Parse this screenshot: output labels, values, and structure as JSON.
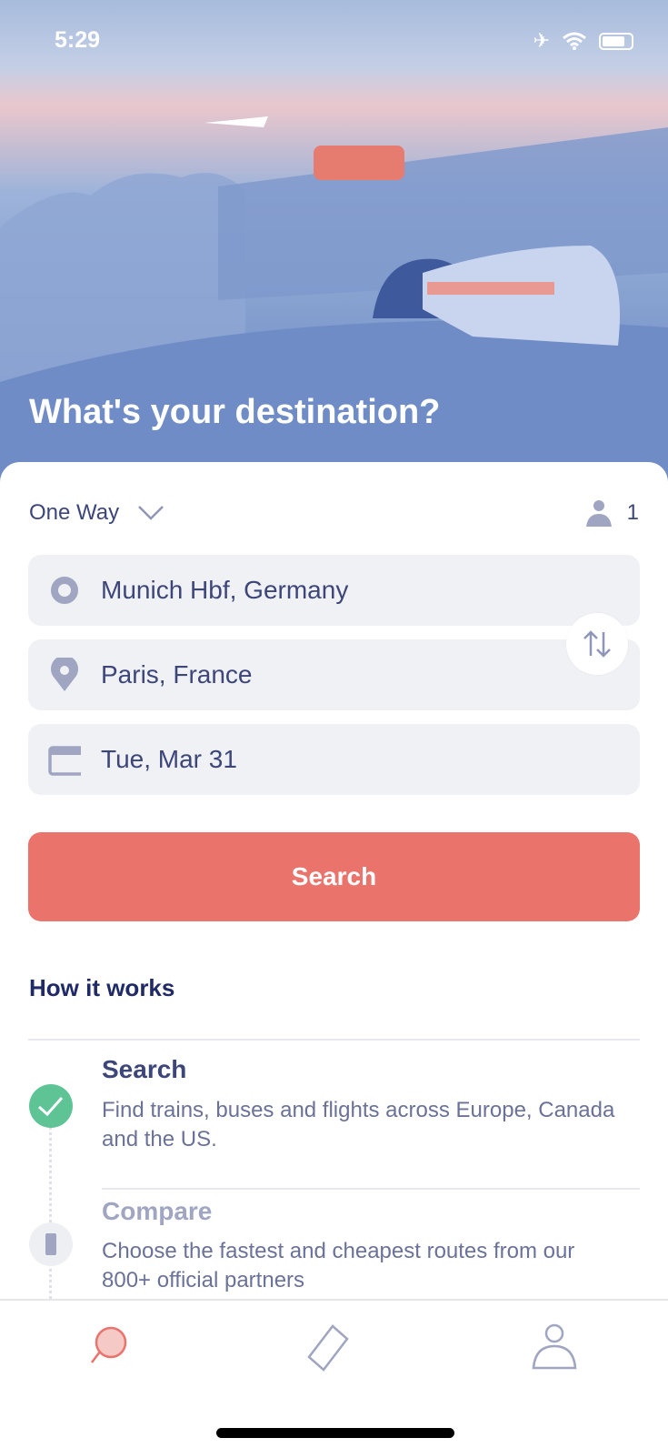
{
  "status_bar": {
    "time": "5:29",
    "icons": [
      "airplane-mode-icon",
      "wifi-icon",
      "battery-icon"
    ]
  },
  "hero": {
    "title": "What's your destination?"
  },
  "trip": {
    "type": "One Way",
    "passengers": "1"
  },
  "fields": {
    "origin": "Munich Hbf, Germany",
    "destination": "Paris, France",
    "date": "Tue, Mar 31"
  },
  "search_button": "Search",
  "how_it_works": {
    "title": "How it works",
    "steps": [
      {
        "title": "Search",
        "description": "Find trains, buses and flights across Europe, Canada and the US.",
        "done": true
      },
      {
        "title": "Compare",
        "description": "Choose the fastest and cheapest routes from our 800+ official partners",
        "done": false
      }
    ]
  },
  "tabbar": {
    "items": [
      "search-tab",
      "tickets-tab",
      "profile-tab"
    ],
    "active": "search-tab"
  },
  "colors": {
    "accent": "#ea736c",
    "primary_text": "#3d4679",
    "success": "#5ec495",
    "field_bg": "#f0f1f5"
  }
}
